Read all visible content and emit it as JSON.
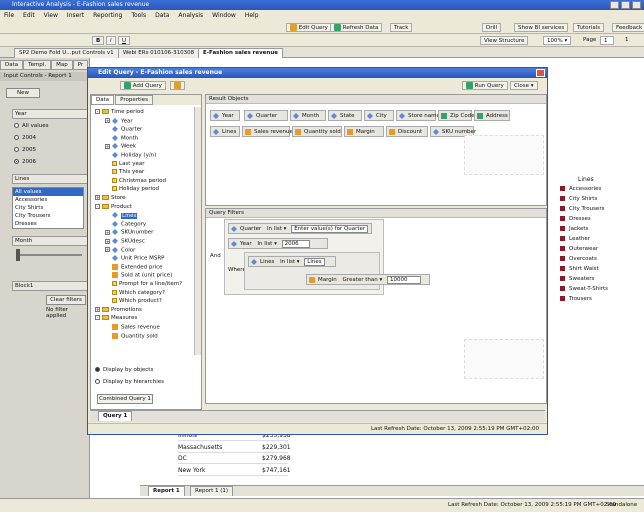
{
  "app": {
    "title": "Interactive Analysis - E-Fashion sales revenue",
    "menu": [
      "File",
      "Edit",
      "View",
      "Insert",
      "Reporting",
      "Tools",
      "Data",
      "Analysis",
      "Window",
      "Help"
    ],
    "toolbar_right": {
      "edit_query": "Edit Query",
      "refresh_data": "Refresh Data",
      "track": "Track",
      "drill": "Drill",
      "show_services": "Show BI services",
      "tutorials": "Tutorials",
      "feedback": "Feedback"
    },
    "toolbar2": {
      "view_structure": "View Structure",
      "zoom": "100%",
      "page_label": "Page",
      "page_value": "1",
      "page_of": "1"
    },
    "doc_tabs": [
      "SP2 Demo Fold U...put Controls v1",
      "Webi ERs 010106-310308",
      "E-Fashion sales revenue"
    ]
  },
  "left_panel": {
    "tabs": [
      "Data",
      "Templ.",
      "Map",
      "Pr"
    ],
    "title": "Input Controls - Report 1",
    "new_button": "New",
    "year_section": "Year",
    "year_options": [
      "All values",
      "2004",
      "2005",
      "2006"
    ],
    "year_selected": 3,
    "lines_section": "Lines",
    "lines_list": [
      "All values",
      "Accessories",
      "City Shirts",
      "City Trousers",
      "Dresses"
    ],
    "lines_selected": 0,
    "month_section": "Month",
    "block_label": "Block1",
    "clear_filters": "Clear filters",
    "no_filter": "No filter applied"
  },
  "report": {
    "legend_title": "Lines",
    "legend": [
      "Accessories",
      "City Shirts",
      "City Trousers",
      "Dresses",
      "Jackets",
      "Leather",
      "Outerwear",
      "Overcoats",
      "Shirt Waist",
      "Sweaters",
      "Sweat-T-Shirts",
      "Trousers"
    ],
    "table_rows": [
      {
        "state": "Illinois",
        "value": "$235,958"
      },
      {
        "state": "Massachusetts",
        "value": "$229,301"
      },
      {
        "state": "DC",
        "value": "$279,968"
      },
      {
        "state": "New York",
        "value": "$747,161"
      }
    ],
    "bottom_tabs": [
      "Report 1",
      "Report 1 (1)"
    ],
    "status": "Last Refresh Date: October 13, 2009 2:55:19 PM GMT+02:00",
    "status_mode": "Standalone"
  },
  "dialog": {
    "title": "Edit Query - E-Fashion sales revenue",
    "add_query": "Add Query",
    "run_query": "Run Query",
    "close": "Close",
    "left_tabs": [
      "Data",
      "Properties"
    ],
    "tree": [
      {
        "label": "Time period",
        "kind": "folder",
        "level": 0,
        "exp": "-"
      },
      {
        "label": "Year",
        "kind": "dim",
        "level": 1,
        "exp": "+"
      },
      {
        "label": "Quarter",
        "kind": "dim",
        "level": 1,
        "exp": ""
      },
      {
        "label": "Month",
        "kind": "dim",
        "level": 1,
        "exp": ""
      },
      {
        "label": "Week",
        "kind": "dim",
        "level": 1,
        "exp": "+"
      },
      {
        "label": "Holiday (y/n)",
        "kind": "dim",
        "level": 1,
        "exp": ""
      },
      {
        "label": "Last year",
        "kind": "filter",
        "level": 1,
        "exp": ""
      },
      {
        "label": "This year",
        "kind": "filter",
        "level": 1,
        "exp": ""
      },
      {
        "label": "Christmas period",
        "kind": "filter",
        "level": 1,
        "exp": ""
      },
      {
        "label": "Holiday period",
        "kind": "filter",
        "level": 1,
        "exp": ""
      },
      {
        "label": "Store",
        "kind": "folder",
        "level": 0,
        "exp": "+"
      },
      {
        "label": "Product",
        "kind": "folder",
        "level": 0,
        "exp": "-"
      },
      {
        "label": "Lines",
        "kind": "dim",
        "level": 1,
        "exp": "",
        "sel": true
      },
      {
        "label": "Category",
        "kind": "dim",
        "level": 1,
        "exp": ""
      },
      {
        "label": "SKUnumber",
        "kind": "dim",
        "level": 1,
        "exp": "+"
      },
      {
        "label": "SKUdesc",
        "kind": "dim",
        "level": 1,
        "exp": "+"
      },
      {
        "label": "Color",
        "kind": "dim",
        "level": 1,
        "exp": "+"
      },
      {
        "label": "Unit Price MSRP",
        "kind": "dim",
        "level": 1,
        "exp": ""
      },
      {
        "label": "Extended price",
        "kind": "mes",
        "level": 1,
        "exp": ""
      },
      {
        "label": "Sold at (unit price)",
        "kind": "mes",
        "level": 1,
        "exp": ""
      },
      {
        "label": "Prompt for a line/item?",
        "kind": "filter",
        "level": 1,
        "exp": ""
      },
      {
        "label": "Which category?",
        "kind": "filter",
        "level": 1,
        "exp": ""
      },
      {
        "label": "Which product?",
        "kind": "filter",
        "level": 1,
        "exp": ""
      },
      {
        "label": "Promotions",
        "kind": "folder",
        "level": 0,
        "exp": "+"
      },
      {
        "label": "Measures",
        "kind": "folder",
        "level": 0,
        "exp": "-"
      },
      {
        "label": "Sales revenue",
        "kind": "mes",
        "level": 1,
        "exp": ""
      },
      {
        "label": "Quantity sold",
        "kind": "mes",
        "level": 1,
        "exp": ""
      }
    ],
    "display_by_objects": "Display by objects",
    "display_by_hierarchies": "Display by hierarchies",
    "combined_query": "Combined Query 1",
    "result_objects_title": "Result Objects",
    "result_objects": [
      {
        "label": "Year",
        "kind": "dim"
      },
      {
        "label": "Quarter",
        "kind": "dim"
      },
      {
        "label": "Month",
        "kind": "dim"
      },
      {
        "label": "State",
        "kind": "dim"
      },
      {
        "label": "City",
        "kind": "dim"
      },
      {
        "label": "Store name",
        "kind": "dim"
      },
      {
        "label": "Zip Code",
        "kind": "det"
      },
      {
        "label": "Address",
        "kind": "det"
      },
      {
        "label": "Lines",
        "kind": "dim"
      },
      {
        "label": "Sales revenue",
        "kind": "mes"
      },
      {
        "label": "Quantity sold",
        "kind": "mes"
      },
      {
        "label": "Margin",
        "kind": "mes"
      },
      {
        "label": "Discount",
        "kind": "mes"
      },
      {
        "label": "SKU number",
        "kind": "dim"
      }
    ],
    "query_filters_title": "Query Filters",
    "filters": {
      "and_label": "And",
      "or_label": "Where",
      "f1_obj": "Quarter",
      "f1_op": "In list",
      "f1_val": "Enter value(s) for Quarter",
      "f2_obj": "Year",
      "f2_op": "In list",
      "f2_val": "2006",
      "f3_obj": "Lines",
      "f3_op": "In list",
      "f3_val": "Lines",
      "f4_obj": "Margin",
      "f4_op": "Greater than",
      "f4_val": "10000"
    },
    "query_tab": "Query 1",
    "status": "Last Refresh Date: October 13, 2009 2:55:19 PM GMT+02:00"
  },
  "colors": {
    "accent": "#2a56b8",
    "selection": "#316ac5",
    "legend_swatch": "#8b1a2a"
  }
}
